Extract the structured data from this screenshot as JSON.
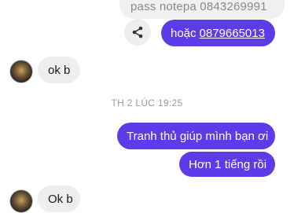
{
  "messages": {
    "top_partial": "pass notepa 0843269991",
    "hoac_prefix": "hoặc",
    "hoac_link": "0879665013",
    "incoming_1": "ok b",
    "timestamp": "TH 2 LÚC 19:25",
    "outgoing_1": "Tranh thủ giúp mình bạn ơi",
    "outgoing_2": "Hơn 1 tiếng rồi",
    "incoming_2": "Ok b"
  },
  "icons": {
    "share": "share-icon",
    "avatar": "avatar"
  },
  "colors": {
    "outgoing_bubble": "#5b3ce8",
    "incoming_bubble": "#eeeeee",
    "timestamp_text": "#9a9a9a"
  }
}
